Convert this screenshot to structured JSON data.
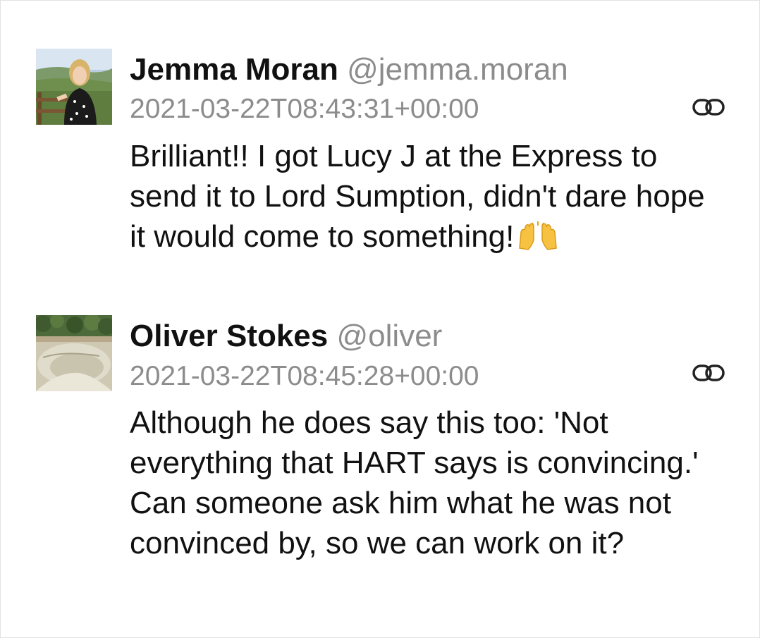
{
  "posts": [
    {
      "author_name": "Jemma Moran",
      "author_handle": "@jemma.moran",
      "timestamp": "2021-03-22T08:43:31+00:00",
      "text": "Brilliant!! I got Lucy J at the Express to send it to Lord Sumption, didn't dare hope it would come to something!",
      "emoji": "raising-hands",
      "avatar": "woman-in-countryside-photo",
      "link_icon": "link-icon"
    },
    {
      "author_name": "Oliver Stokes",
      "author_handle": "@oliver",
      "timestamp": "2021-03-22T08:45:28+00:00",
      "text": "Although he does say this too: 'Not everything that HART says is convincing.' Can someone ask him what he was not convinced by, so we can work on it?",
      "avatar": "skatepark-bowl-photo",
      "link_icon": "link-icon"
    }
  ],
  "colors": {
    "text": "#111111",
    "muted": "#8c8c8c",
    "background": "#ffffff"
  }
}
